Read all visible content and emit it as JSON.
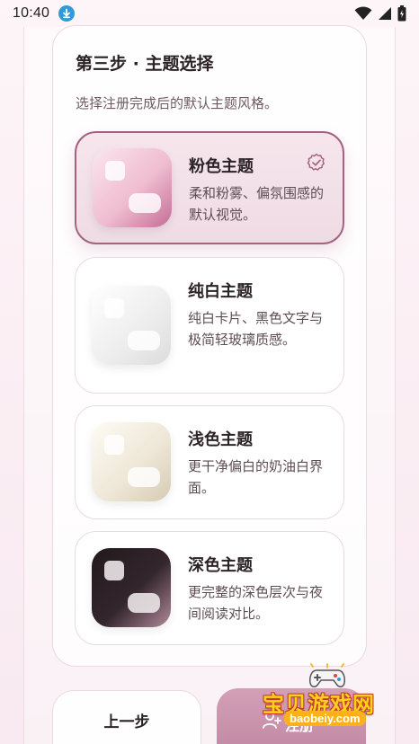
{
  "status_bar": {
    "time": "10:40",
    "download_icon": "download-arrow-icon",
    "wifi_icon": "wifi-icon",
    "signal_icon": "cell-signal-icon",
    "battery_icon": "battery-icon"
  },
  "step": {
    "title": "第三步 · 主题选择",
    "subtitle": "选择注册完成后的默认主题风格。"
  },
  "themes": [
    {
      "name": "粉色主题",
      "description": "柔和粉雾、偏氛围感的默认视觉。",
      "selected": true
    },
    {
      "name": "纯白主题",
      "description": "纯白卡片、黑色文字与极简轻玻璃质感。",
      "selected": false
    },
    {
      "name": "浅色主题",
      "description": "更干净偏白的奶油白界面。",
      "selected": false
    },
    {
      "name": "深色主题",
      "description": "更完整的深色层次与夜间阅读对比。",
      "selected": false
    }
  ],
  "buttons": {
    "prev_label": "上一步",
    "next_label": "注册"
  },
  "watermark": {
    "title": "宝贝游戏网",
    "url": "baobeiy.com"
  },
  "colors": {
    "accent": "#a46283",
    "primary_button": "#c48ca6",
    "background": "#fbeff4"
  }
}
